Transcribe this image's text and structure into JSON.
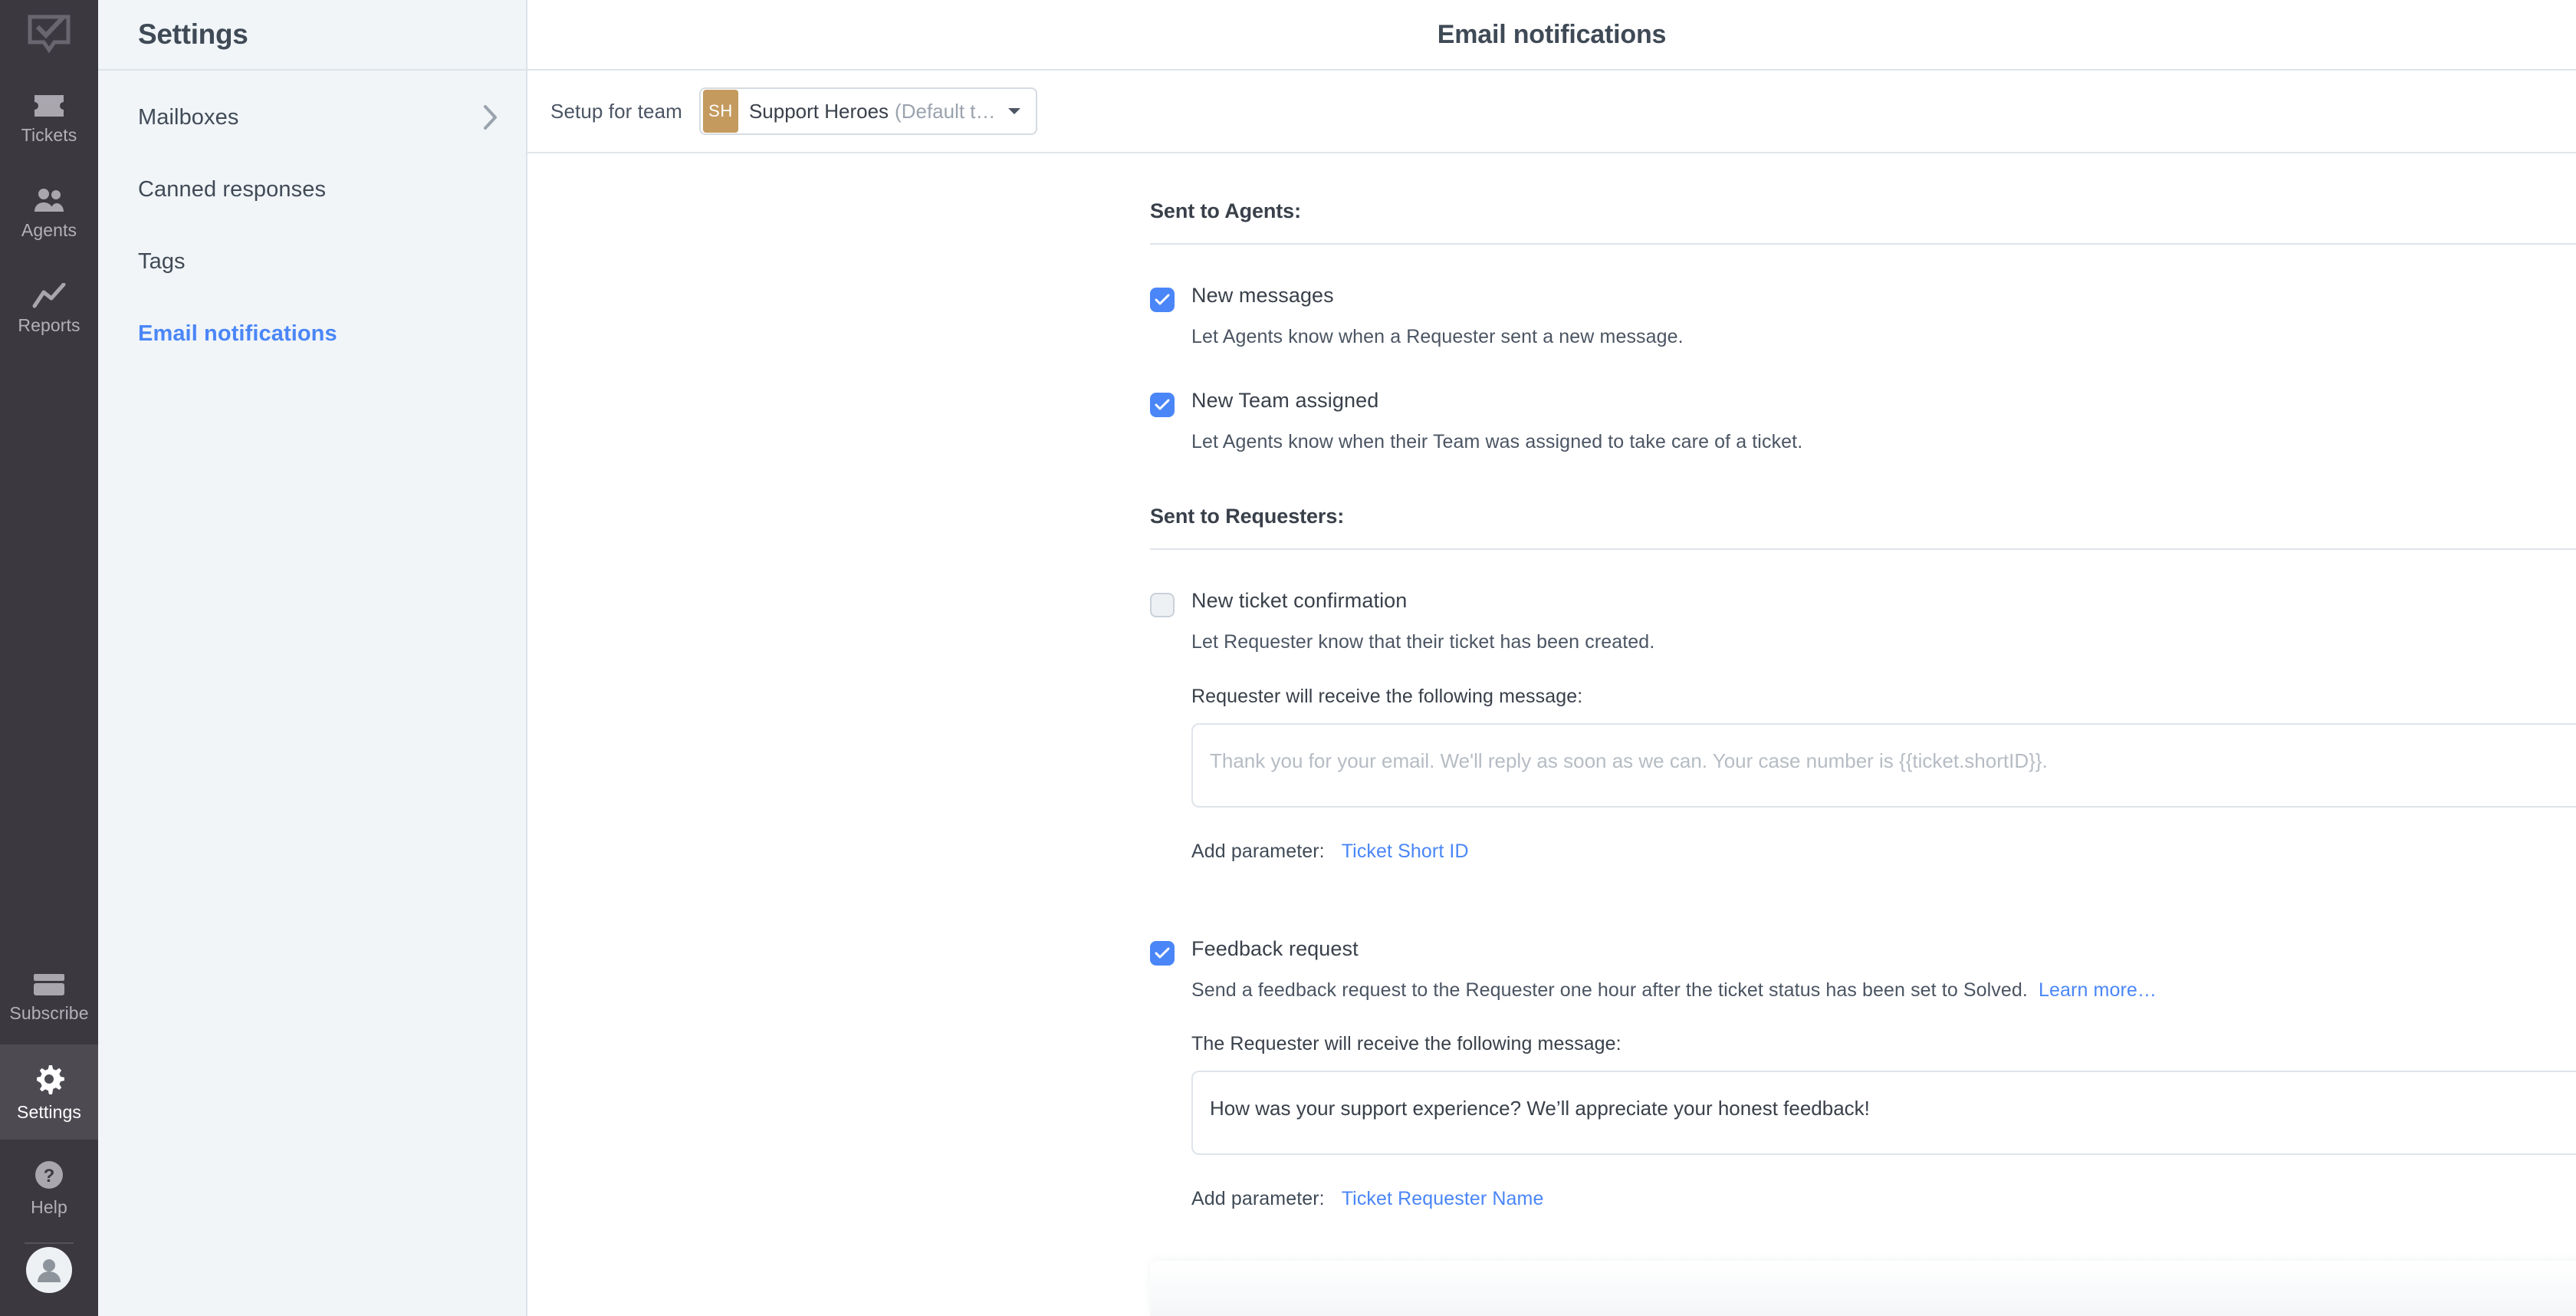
{
  "rail": {
    "logo_icon": "inbox-check-logo-icon",
    "items": [
      {
        "label": "Tickets",
        "icon": "ticket-icon",
        "active": false
      },
      {
        "label": "Agents",
        "icon": "agents-icon",
        "active": false
      },
      {
        "label": "Reports",
        "icon": "chart-line-icon",
        "active": false
      }
    ],
    "bottom_items": [
      {
        "label": "Subscribe",
        "icon": "credit-card-icon",
        "active": false
      },
      {
        "label": "Settings",
        "icon": "gear-icon",
        "active": true
      },
      {
        "label": "Help",
        "icon": "question-circle-icon",
        "active": false
      }
    ],
    "avatar_icon": "user-avatar-icon"
  },
  "settings_nav": {
    "title": "Settings",
    "items": [
      {
        "label": "Mailboxes",
        "has_chevron": true,
        "active": false
      },
      {
        "label": "Canned responses",
        "has_chevron": false,
        "active": false
      },
      {
        "label": "Tags",
        "has_chevron": false,
        "active": false
      },
      {
        "label": "Email notifications",
        "has_chevron": false,
        "active": true
      }
    ]
  },
  "header": {
    "title": "Email notifications"
  },
  "team_bar": {
    "label": "Setup for team",
    "avatar_initials": "SH",
    "avatar_color": "#c49a5e",
    "team_name": "Support Heroes",
    "team_suffix": "(Default t…",
    "caret_icon": "chevron-down-icon"
  },
  "sections": {
    "agents": {
      "title": "Sent to Agents:",
      "options": [
        {
          "label": "New messages",
          "checked": true,
          "description": "Let Agents know when a Requester sent a new message."
        },
        {
          "label": "New Team assigned",
          "checked": true,
          "description": "Let Agents know when their Team was assigned to take care of a ticket."
        }
      ]
    },
    "requesters": {
      "title": "Sent to Requesters:",
      "options": [
        {
          "label": "New ticket confirmation",
          "checked": false,
          "description": "Let Requester know that their ticket has been created.",
          "message_label": "Requester will receive the following message:",
          "message_value": "",
          "message_placeholder": "Thank you for your email. We'll reply as soon as we can. Your case number is {{ticket.shortID}}.",
          "param_label": "Add parameter:",
          "param_link": "Ticket Short ID"
        },
        {
          "label": "Feedback request",
          "checked": true,
          "description": "Send a feedback request to the Requester one hour after the ticket status has been set to Solved.",
          "learn_more": "Learn more…",
          "message_label": "The Requester will receive the following message:",
          "message_value": "How was your support experience? We’ll appreciate your honest feedback!",
          "message_placeholder": "",
          "param_label": "Add parameter:",
          "param_link": "Ticket Requester Name"
        }
      ]
    }
  },
  "colors": {
    "accent": "#4a86f7",
    "rail_bg": "#3b383f",
    "nav_bg": "#f1f5f8",
    "text": "#39404a",
    "muted": "#9aa3ad"
  }
}
